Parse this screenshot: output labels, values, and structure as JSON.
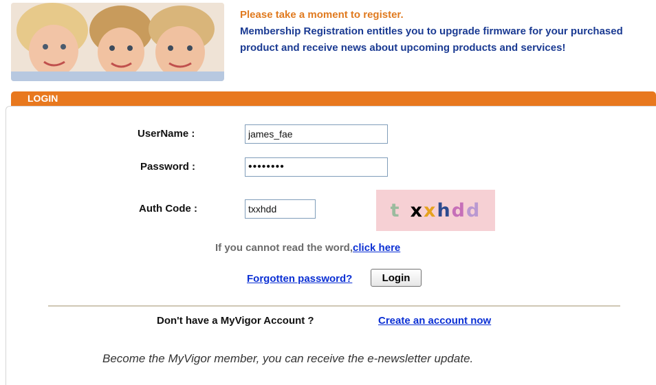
{
  "banner": {
    "image_alt": "three smiling children",
    "headline": "Please take a moment to register.",
    "description": "Membership Registration entitles you to upgrade firmware for your purchased product and receive news about upcoming products and services!"
  },
  "section": {
    "title": "LOGIN"
  },
  "form": {
    "username_label": "UserName :",
    "username_value": "james_fae",
    "password_label": "Password :",
    "password_value": "••••••••",
    "authcode_label": "Auth Code :",
    "authcode_value": "txxhdd",
    "captcha_chars": [
      "t",
      "x",
      "x",
      "h",
      "d",
      "d"
    ],
    "captcha_hint": "If you cannot read the word,",
    "captcha_refresh_link": "click here",
    "forgot_link": "Forgotten password?",
    "login_button": "Login"
  },
  "signup": {
    "prompt": "Don't have a MyVigor Account ?",
    "create_link": "Create an account now",
    "newsletter": "Become the MyVigor member, you can receive the e-newsletter update."
  },
  "colors": {
    "accent_orange": "#e8781e",
    "headline_orange": "#e07a1f",
    "body_blue": "#1a3a92",
    "link_blue": "#0a2fd4",
    "captcha_bg": "#f6d0d4"
  }
}
